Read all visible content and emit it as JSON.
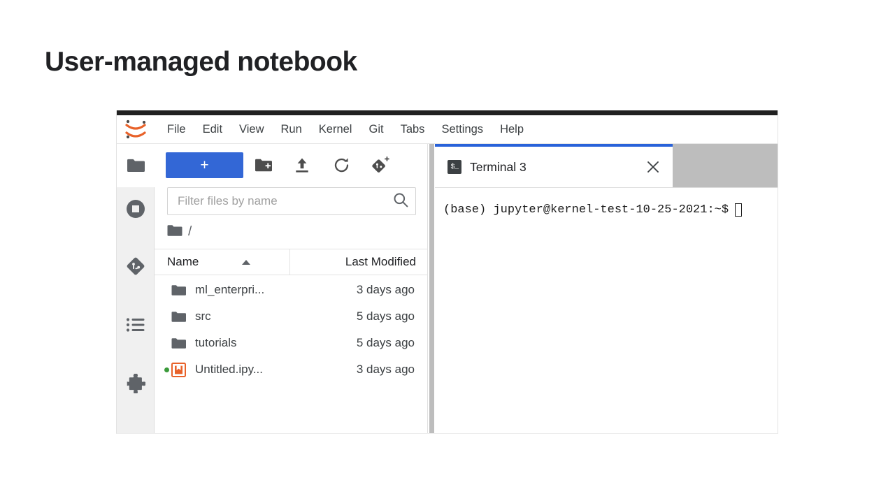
{
  "slide": {
    "title": "User-managed notebook"
  },
  "app": {
    "logo_icon": "jupyter-logo-icon",
    "menus": [
      {
        "label": "File"
      },
      {
        "label": "Edit"
      },
      {
        "label": "View"
      },
      {
        "label": "Run"
      },
      {
        "label": "Kernel"
      },
      {
        "label": "Git"
      },
      {
        "label": "Tabs"
      },
      {
        "label": "Settings"
      },
      {
        "label": "Help"
      }
    ]
  },
  "sidebar": {
    "items": [
      {
        "name": "file-browser",
        "icon": "folder-icon",
        "active": true
      },
      {
        "name": "running-sessions",
        "icon": "stop-circle-icon",
        "active": false
      },
      {
        "name": "git-panel",
        "icon": "git-diamond-icon",
        "active": false
      },
      {
        "name": "commands-palette",
        "icon": "list-icon",
        "active": false
      },
      {
        "name": "extension-manager",
        "icon": "puzzle-piece-icon",
        "active": false
      }
    ]
  },
  "browser": {
    "toolbar": {
      "new_launcher_label": "+",
      "buttons": [
        {
          "name": "new-folder-button",
          "icon": "new-folder-icon"
        },
        {
          "name": "upload-button",
          "icon": "upload-icon"
        },
        {
          "name": "refresh-button",
          "icon": "refresh-icon"
        },
        {
          "name": "git-clone-button",
          "icon": "git-clone-plus-icon"
        }
      ]
    },
    "filter": {
      "value": "",
      "placeholder": "Filter files by name",
      "icon": "search-icon"
    },
    "breadcrumb": {
      "root_icon": "folder-icon",
      "path": "/"
    },
    "columns": {
      "name": "Name",
      "last_modified": "Last Modified",
      "sort": "ascending"
    },
    "files": [
      {
        "name": "ml_enterpri...",
        "modified": "3 days ago",
        "icon": "folder-icon",
        "running": false
      },
      {
        "name": "src",
        "modified": "5 days ago",
        "icon": "folder-icon",
        "running": false
      },
      {
        "name": "tutorials",
        "modified": "5 days ago",
        "icon": "folder-icon",
        "running": false
      },
      {
        "name": "Untitled.ipy...",
        "modified": "3 days ago",
        "icon": "notebook-icon",
        "running": true
      }
    ]
  },
  "dock": {
    "tab": {
      "label": "Terminal 3",
      "icon": "terminal-prompt-icon",
      "close_icon": "close-icon",
      "active": true
    },
    "terminal": {
      "prompt": "(base) jupyter@kernel-test-10-25-2021:~$"
    }
  },
  "colors": {
    "accent_blue": "#3367d6",
    "tab_active_border": "#2962d9",
    "jupyter_orange": "#e8622a",
    "running_green": "#3a9a3a",
    "tabbar_gray": "#bdbdbd",
    "topbar_black": "#212121"
  }
}
